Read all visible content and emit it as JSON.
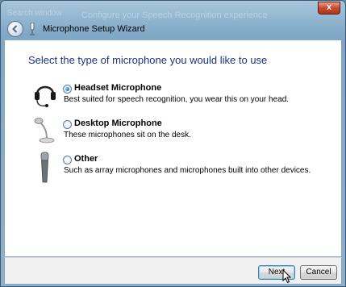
{
  "window": {
    "title": "Microphone Setup Wizard",
    "background_title": "Configure your Speech Recognition experience",
    "background_left": "Search window",
    "close_label": "x"
  },
  "main": {
    "heading": "Select the type of microphone you would like to use",
    "options": [
      {
        "label": "Headset Microphone",
        "description": "Best suited for speech recognition, you wear this on your head.",
        "selected": true,
        "icon": "headset-icon"
      },
      {
        "label": "Desktop Microphone",
        "description": "These microphones sit on the desk.",
        "selected": false,
        "icon": "desktop-mic-icon"
      },
      {
        "label": "Other",
        "description": "Such as array microphones and microphones built into other devices.",
        "selected": false,
        "icon": "handheld-mic-icon"
      }
    ]
  },
  "footer": {
    "next_label": "Next",
    "cancel_label": "Cancel"
  },
  "colors": {
    "heading": "#1e3287",
    "frame": "#7fa7c6"
  }
}
